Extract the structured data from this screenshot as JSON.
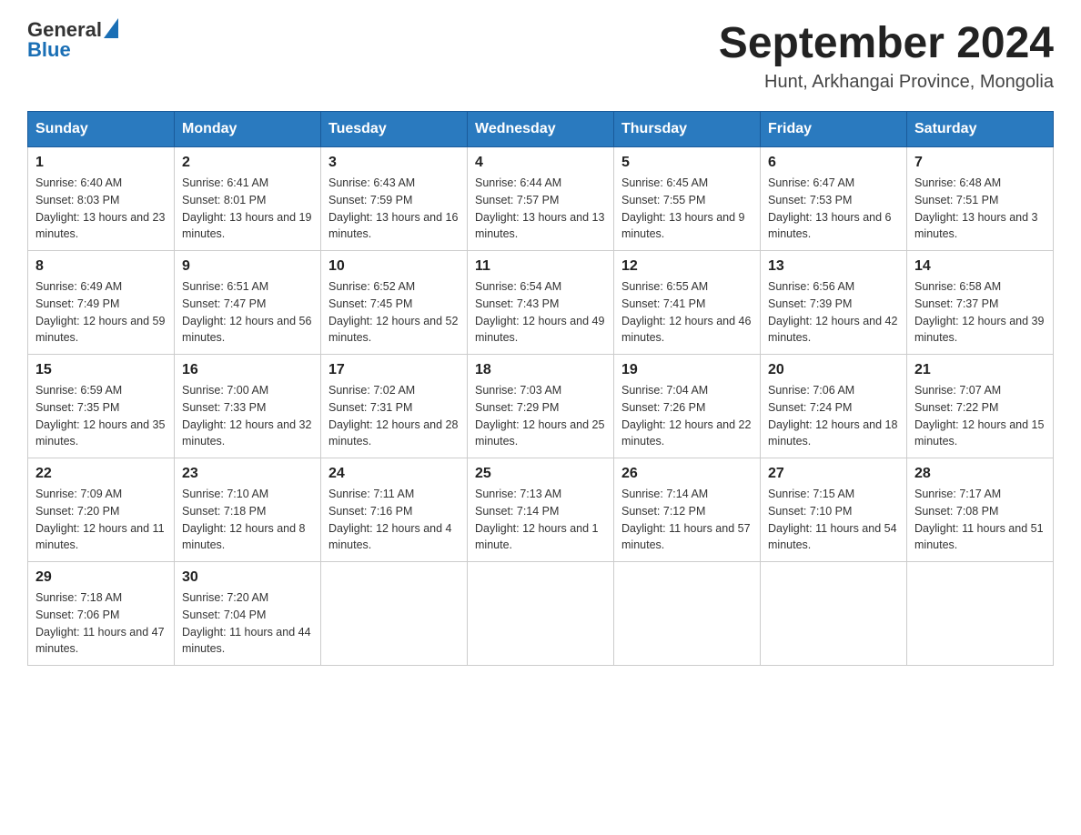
{
  "header": {
    "logo": {
      "text_general": "General",
      "text_blue": "Blue"
    },
    "title": "September 2024",
    "subtitle": "Hunt, Arkhangai Province, Mongolia"
  },
  "days_of_week": [
    "Sunday",
    "Monday",
    "Tuesday",
    "Wednesday",
    "Thursday",
    "Friday",
    "Saturday"
  ],
  "weeks": [
    [
      {
        "day": "1",
        "sunrise": "Sunrise: 6:40 AM",
        "sunset": "Sunset: 8:03 PM",
        "daylight": "Daylight: 13 hours and 23 minutes."
      },
      {
        "day": "2",
        "sunrise": "Sunrise: 6:41 AM",
        "sunset": "Sunset: 8:01 PM",
        "daylight": "Daylight: 13 hours and 19 minutes."
      },
      {
        "day": "3",
        "sunrise": "Sunrise: 6:43 AM",
        "sunset": "Sunset: 7:59 PM",
        "daylight": "Daylight: 13 hours and 16 minutes."
      },
      {
        "day": "4",
        "sunrise": "Sunrise: 6:44 AM",
        "sunset": "Sunset: 7:57 PM",
        "daylight": "Daylight: 13 hours and 13 minutes."
      },
      {
        "day": "5",
        "sunrise": "Sunrise: 6:45 AM",
        "sunset": "Sunset: 7:55 PM",
        "daylight": "Daylight: 13 hours and 9 minutes."
      },
      {
        "day": "6",
        "sunrise": "Sunrise: 6:47 AM",
        "sunset": "Sunset: 7:53 PM",
        "daylight": "Daylight: 13 hours and 6 minutes."
      },
      {
        "day": "7",
        "sunrise": "Sunrise: 6:48 AM",
        "sunset": "Sunset: 7:51 PM",
        "daylight": "Daylight: 13 hours and 3 minutes."
      }
    ],
    [
      {
        "day": "8",
        "sunrise": "Sunrise: 6:49 AM",
        "sunset": "Sunset: 7:49 PM",
        "daylight": "Daylight: 12 hours and 59 minutes."
      },
      {
        "day": "9",
        "sunrise": "Sunrise: 6:51 AM",
        "sunset": "Sunset: 7:47 PM",
        "daylight": "Daylight: 12 hours and 56 minutes."
      },
      {
        "day": "10",
        "sunrise": "Sunrise: 6:52 AM",
        "sunset": "Sunset: 7:45 PM",
        "daylight": "Daylight: 12 hours and 52 minutes."
      },
      {
        "day": "11",
        "sunrise": "Sunrise: 6:54 AM",
        "sunset": "Sunset: 7:43 PM",
        "daylight": "Daylight: 12 hours and 49 minutes."
      },
      {
        "day": "12",
        "sunrise": "Sunrise: 6:55 AM",
        "sunset": "Sunset: 7:41 PM",
        "daylight": "Daylight: 12 hours and 46 minutes."
      },
      {
        "day": "13",
        "sunrise": "Sunrise: 6:56 AM",
        "sunset": "Sunset: 7:39 PM",
        "daylight": "Daylight: 12 hours and 42 minutes."
      },
      {
        "day": "14",
        "sunrise": "Sunrise: 6:58 AM",
        "sunset": "Sunset: 7:37 PM",
        "daylight": "Daylight: 12 hours and 39 minutes."
      }
    ],
    [
      {
        "day": "15",
        "sunrise": "Sunrise: 6:59 AM",
        "sunset": "Sunset: 7:35 PM",
        "daylight": "Daylight: 12 hours and 35 minutes."
      },
      {
        "day": "16",
        "sunrise": "Sunrise: 7:00 AM",
        "sunset": "Sunset: 7:33 PM",
        "daylight": "Daylight: 12 hours and 32 minutes."
      },
      {
        "day": "17",
        "sunrise": "Sunrise: 7:02 AM",
        "sunset": "Sunset: 7:31 PM",
        "daylight": "Daylight: 12 hours and 28 minutes."
      },
      {
        "day": "18",
        "sunrise": "Sunrise: 7:03 AM",
        "sunset": "Sunset: 7:29 PM",
        "daylight": "Daylight: 12 hours and 25 minutes."
      },
      {
        "day": "19",
        "sunrise": "Sunrise: 7:04 AM",
        "sunset": "Sunset: 7:26 PM",
        "daylight": "Daylight: 12 hours and 22 minutes."
      },
      {
        "day": "20",
        "sunrise": "Sunrise: 7:06 AM",
        "sunset": "Sunset: 7:24 PM",
        "daylight": "Daylight: 12 hours and 18 minutes."
      },
      {
        "day": "21",
        "sunrise": "Sunrise: 7:07 AM",
        "sunset": "Sunset: 7:22 PM",
        "daylight": "Daylight: 12 hours and 15 minutes."
      }
    ],
    [
      {
        "day": "22",
        "sunrise": "Sunrise: 7:09 AM",
        "sunset": "Sunset: 7:20 PM",
        "daylight": "Daylight: 12 hours and 11 minutes."
      },
      {
        "day": "23",
        "sunrise": "Sunrise: 7:10 AM",
        "sunset": "Sunset: 7:18 PM",
        "daylight": "Daylight: 12 hours and 8 minutes."
      },
      {
        "day": "24",
        "sunrise": "Sunrise: 7:11 AM",
        "sunset": "Sunset: 7:16 PM",
        "daylight": "Daylight: 12 hours and 4 minutes."
      },
      {
        "day": "25",
        "sunrise": "Sunrise: 7:13 AM",
        "sunset": "Sunset: 7:14 PM",
        "daylight": "Daylight: 12 hours and 1 minute."
      },
      {
        "day": "26",
        "sunrise": "Sunrise: 7:14 AM",
        "sunset": "Sunset: 7:12 PM",
        "daylight": "Daylight: 11 hours and 57 minutes."
      },
      {
        "day": "27",
        "sunrise": "Sunrise: 7:15 AM",
        "sunset": "Sunset: 7:10 PM",
        "daylight": "Daylight: 11 hours and 54 minutes."
      },
      {
        "day": "28",
        "sunrise": "Sunrise: 7:17 AM",
        "sunset": "Sunset: 7:08 PM",
        "daylight": "Daylight: 11 hours and 51 minutes."
      }
    ],
    [
      {
        "day": "29",
        "sunrise": "Sunrise: 7:18 AM",
        "sunset": "Sunset: 7:06 PM",
        "daylight": "Daylight: 11 hours and 47 minutes."
      },
      {
        "day": "30",
        "sunrise": "Sunrise: 7:20 AM",
        "sunset": "Sunset: 7:04 PM",
        "daylight": "Daylight: 11 hours and 44 minutes."
      },
      null,
      null,
      null,
      null,
      null
    ]
  ]
}
